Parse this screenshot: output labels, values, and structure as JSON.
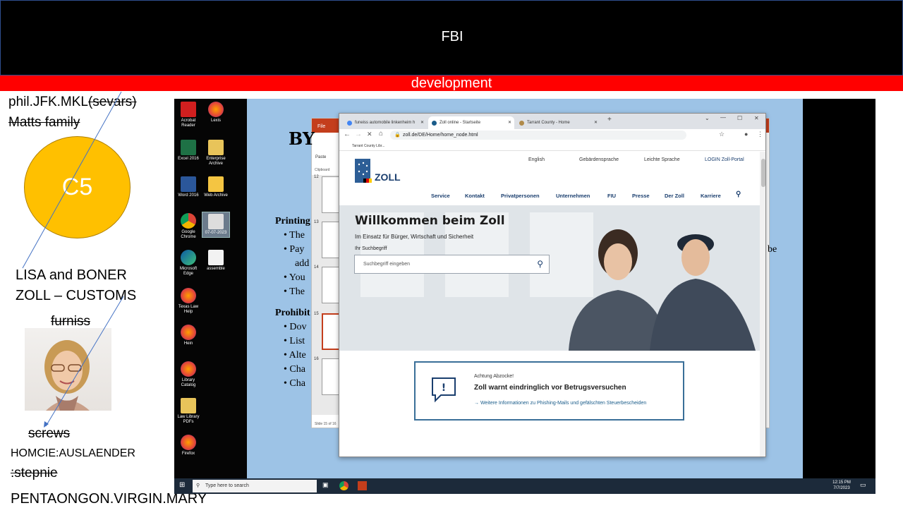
{
  "slide": {
    "header_title": "FBI",
    "banner_text": "development",
    "notes": {
      "line1_a": "phil.JFK.MKL",
      "line1_b": "(sevars)",
      "line2": "Matts family",
      "circle": "C5",
      "line3": "LISA and BONER",
      "line4": "ZOLL – CUSTOMS",
      "line5": "furniss",
      "line6": "screws",
      "line7": "HOMCIE:AUSLAENDER",
      "line8": ":stepnie",
      "line9": "PENTAONGON.VIRGIN.MARY"
    },
    "colors": {
      "header": "#000000",
      "banner": "#ff0000",
      "circle": "#ffc000"
    }
  },
  "desktop": {
    "icons": [
      {
        "label": "Acrobat Reader",
        "icon": "acrobat-icon"
      },
      {
        "label": "Lexis",
        "icon": "firefox-icon"
      },
      {
        "label": "Excel 2016",
        "icon": "excel-icon"
      },
      {
        "label": "Enterprise Archive",
        "icon": "archive-icon"
      },
      {
        "label": "Word 2016",
        "icon": "word-icon"
      },
      {
        "label": "Web Archive",
        "icon": "folder-icon"
      },
      {
        "label": "Google Chrome",
        "icon": "chrome-icon"
      },
      {
        "label": "07-07-2023",
        "icon": "folder-icon"
      },
      {
        "label": "Microsoft Edge",
        "icon": "edge-icon"
      },
      {
        "label": "assemble",
        "icon": "file-icon"
      },
      {
        "label": "Texas Law Help",
        "icon": "firefox-icon"
      },
      {
        "label": "Hein",
        "icon": "firefox-icon"
      },
      {
        "label": "Library Catalog",
        "icon": "firefox-icon"
      },
      {
        "label": "Law Library PDFs",
        "icon": "archive-icon"
      },
      {
        "label": "Firefox",
        "icon": "firefox-icon"
      }
    ],
    "taskbar": {
      "search_placeholder": "Type here to search",
      "time": "12:15 PM",
      "date": "7/7/2023"
    }
  },
  "ppt": {
    "heading": "BY",
    "lines": [
      "Printing",
      "The",
      "Pay",
      "add",
      "You",
      "The",
      "Prohibit",
      "Dov",
      "List",
      "Alte",
      "Cha",
      "Cha"
    ],
    "slide_numbers": [
      "12",
      "13",
      "14",
      "15",
      "16"
    ],
    "status": "Slide 15 of 16",
    "file_tab": "File",
    "paste": "Paste",
    "clipboard": "Clipboard",
    "right_fragment": "be"
  },
  "browser": {
    "tabs": [
      {
        "title": "funeiss automobile linkenheim h",
        "active": false
      },
      {
        "title": "Zoll online - Startseite",
        "active": true
      },
      {
        "title": "Tarrant County - Home",
        "active": false
      }
    ],
    "url": "zoll.de/DE/Home/home_node.html",
    "bookmark": "Tarrant County Libr..."
  },
  "zoll": {
    "util_links": [
      "English",
      "Gebärdensprache",
      "Leichte Sprache",
      "LOGIN Zoll-Portal"
    ],
    "logo_text": "ZOLL",
    "nav": [
      "Service",
      "Kontakt",
      "Privatpersonen",
      "Unternehmen",
      "FIU",
      "Presse",
      "Der Zoll",
      "Karriere"
    ],
    "hero": {
      "title": "Willkommen beim Zoll",
      "subtitle": "Im Einsatz für Bürger, Wirtschaft und Sicherheit",
      "search_label": "Ihr Suchbegriff",
      "search_placeholder": "Suchbegriff eingeben"
    },
    "alert": {
      "kicker": "Achtung Abzocke!",
      "title": "Zoll warnt eindringlich vor Betrugsversuchen",
      "link": "Weitere Informationen zu Phishing-Mails und gefälschten Steuerbescheiden"
    }
  }
}
